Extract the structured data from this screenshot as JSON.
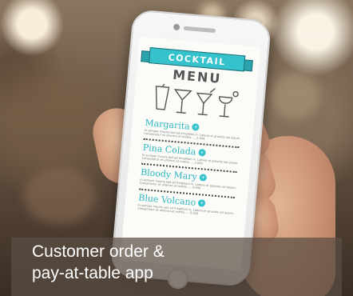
{
  "photo": {
    "subject": "hand holding smartphone",
    "screen": {
      "banner": "COCKTAIL",
      "menu_heading": "MENU",
      "items": [
        {
          "name": "Margarita",
          "description": "In semper mauris sed ad fringillam in. Labore et gravida vel ipsum. Consectetur et ullamco et mattis......2.00$"
        },
        {
          "name": "Pina Colada",
          "description": "In semper mauris sed ad fringillam in. Labore et gravida vel ipsum. Consectetur et ullamco et mattis......3.00$"
        },
        {
          "name": "Bloody Mary",
          "description": "In semper mauris sed ad fringillam in. Labore et gravida vel ipsum. Consectetur et ullamco et mattis......4.00$"
        },
        {
          "name": "Blue Volcano",
          "description": "In semper mauris sed ad fringillam in. Labore et gravida vel ipsum. Consectetur et ullamco et mattis......5.00$"
        }
      ]
    }
  },
  "caption": {
    "line1": "Customer order &",
    "line2": "pay-at-table app"
  },
  "colors": {
    "accent": "#35c2cc",
    "caption_bg": "#5a4e44"
  }
}
